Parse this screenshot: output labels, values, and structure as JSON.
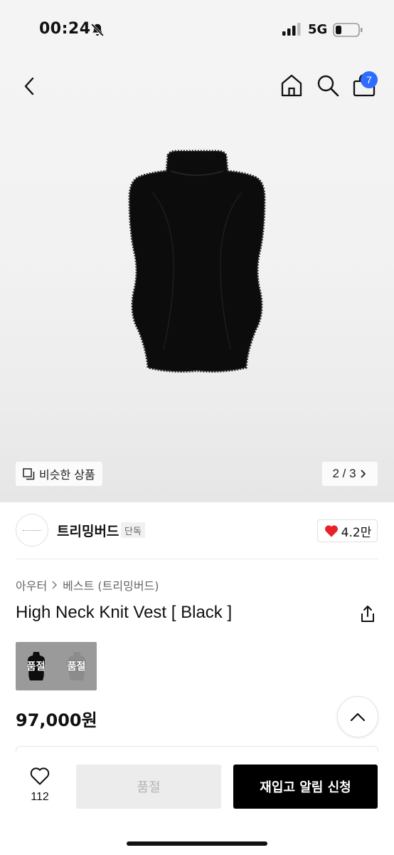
{
  "status_bar": {
    "time": "00:24",
    "network": "5G",
    "icons": [
      "bell-slash-icon",
      "signal-icon",
      "battery-icon"
    ]
  },
  "nav": {
    "icons": [
      "back-icon",
      "home-icon",
      "search-icon",
      "cart-icon"
    ],
    "cart_badge": "7",
    "badge_color": "#2e6bff"
  },
  "gallery": {
    "similar_label": "비슷한 상품",
    "pager_text": "2 / 3"
  },
  "brand": {
    "name": "트리밍버드",
    "tag": "단독",
    "likes": "4.2만",
    "heart_color": "#e8202a"
  },
  "product": {
    "breadcrumb": [
      "아우터",
      "베스트 (트리밍버드)"
    ],
    "title": "High Neck Knit Vest [ Black ]",
    "variants": [
      {
        "label": "품절",
        "color": "black"
      },
      {
        "label": "품절",
        "color": "grey"
      }
    ],
    "price": "97,000원"
  },
  "bottom_bar": {
    "wish_count": "112",
    "soldout_label": "품절",
    "restock_label": "재입고 알림 신청"
  }
}
